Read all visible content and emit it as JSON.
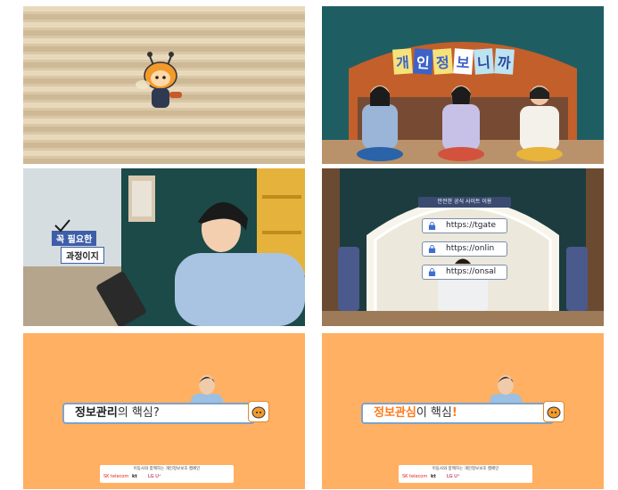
{
  "panel2": {
    "title_chars": [
      "개",
      "인",
      "정",
      "보",
      "니",
      "까"
    ]
  },
  "panel3": {
    "tag_line1": "꼭 필요한",
    "tag_line2": "과정이지"
  },
  "panel4": {
    "banner": "안전한 공식 사이트 이용",
    "urls": [
      "https://tgate",
      "https://onlin",
      "https://onsal"
    ]
  },
  "panel5": {
    "caption_bold": "정보관리",
    "caption_tail": "의 핵심?"
  },
  "panel6": {
    "caption_bold": "정보관심",
    "caption_tail": "이 핵심",
    "caption_excl": "!"
  },
  "footer": {
    "text": "이동사와 함께하는 개인정보보호 캠페인",
    "logos": [
      "SK telecom",
      "kt",
      "LG U⁺"
    ]
  },
  "colors": {
    "orange_bg": "#ffb063",
    "accent_orange": "#ff7a1a"
  }
}
